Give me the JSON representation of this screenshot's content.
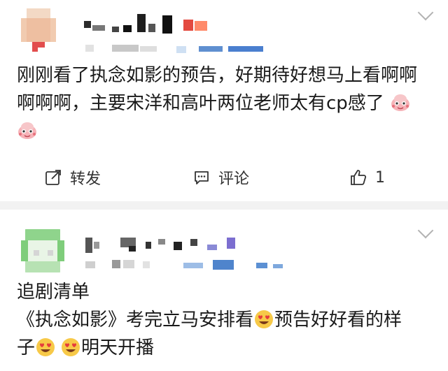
{
  "post1": {
    "text_lines": [
      "刚刚看了执念如影的预告，好期待好想马上看啊啊",
      "啊啊啊，主要宋洋和高叶两位老师太有cp感了"
    ],
    "emoji_1": "pink-face-sticker",
    "emoji_2": "pink-face-sticker",
    "actions": {
      "repost_label": "转发",
      "comment_label": "评论",
      "like_count": "1"
    }
  },
  "post2": {
    "text_lines": [
      "追剧清单",
      "《执念如影》考完立马安排看",
      "预告好好看的样",
      "子",
      "明天开播"
    ],
    "emoji": "heart-eyes-face"
  },
  "colors": {
    "separator": "#f2f2f2",
    "text": "#1a1a1a",
    "icon": "#333333",
    "chevron": "#b3b3b3"
  }
}
